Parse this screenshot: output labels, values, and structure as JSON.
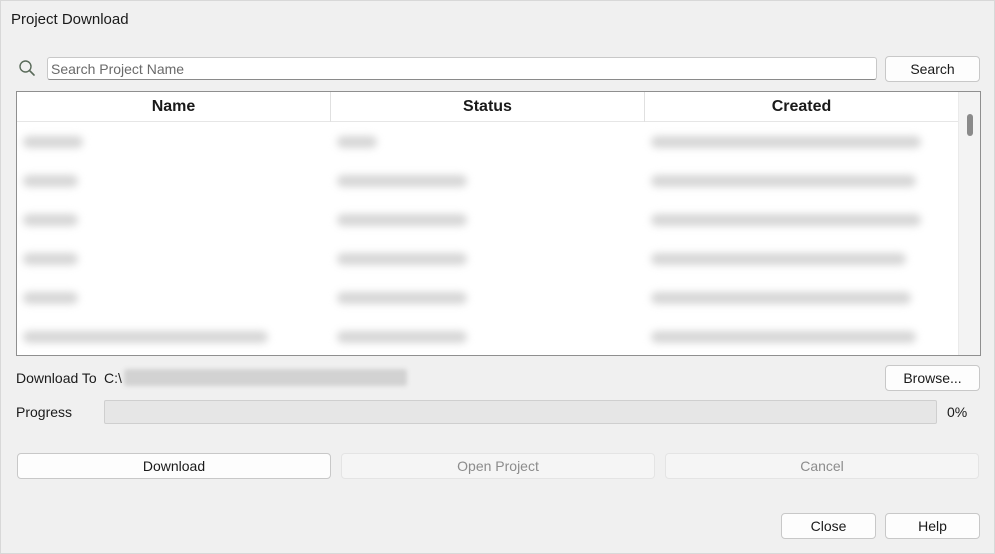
{
  "window": {
    "title": "Project Download"
  },
  "search": {
    "icon": "search-icon",
    "value": "",
    "placeholder": "Search Project Name",
    "button_label": "Search"
  },
  "table": {
    "columns": [
      "Name",
      "Status",
      "Created"
    ]
  },
  "download_to": {
    "label": "Download To",
    "path_prefix": "C:\\",
    "browse_label": "Browse..."
  },
  "progress": {
    "label": "Progress",
    "value": 0,
    "text": "0%"
  },
  "actions": {
    "download": "Download",
    "open_project": "Open Project",
    "cancel": "Cancel"
  },
  "footer": {
    "close": "Close",
    "help": "Help"
  },
  "colors": {
    "background": "#f0f0f0",
    "progress_fill": "#06b025"
  }
}
